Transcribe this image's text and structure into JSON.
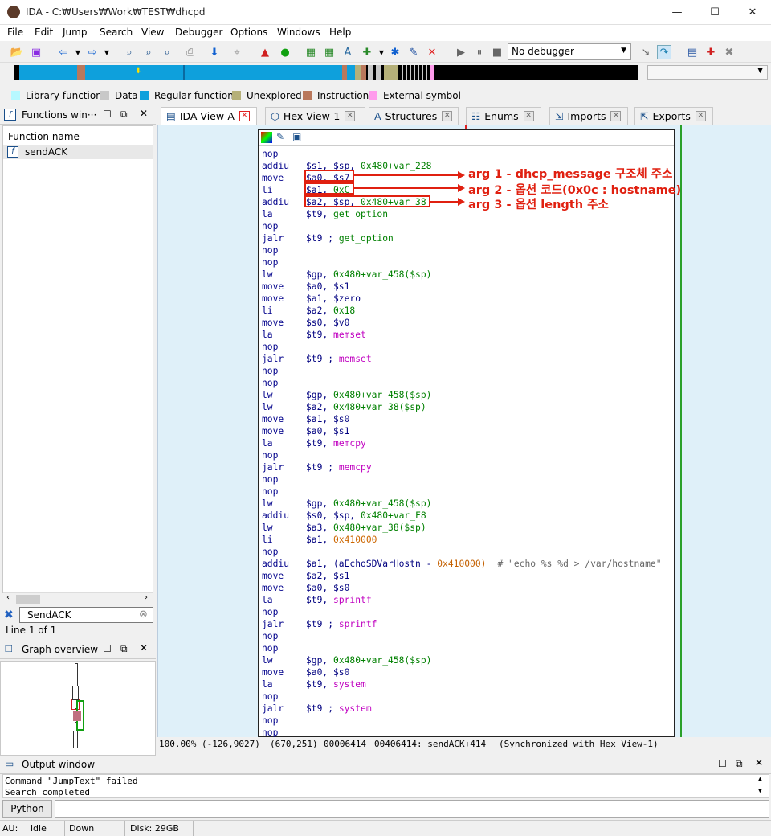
{
  "window": {
    "title": "IDA - C:₩Users₩Work₩TEST₩dhcpd",
    "min": "—",
    "max": "☐",
    "close": "✕"
  },
  "menu": [
    "File",
    "Edit",
    "Jump",
    "Search",
    "View",
    "Debugger",
    "Options",
    "Windows",
    "Help"
  ],
  "debugger_select": "No debugger",
  "legend": [
    {
      "label": "Library function",
      "color": "#b7f8ff"
    },
    {
      "label": "Data",
      "color": "#c8c8c8"
    },
    {
      "label": "Regular function",
      "color": "#0ea0dc"
    },
    {
      "label": "Unexplored",
      "color": "#b5b079"
    },
    {
      "label": "Instruction",
      "color": "#b9785c"
    },
    {
      "label": "External symbol",
      "color": "#ff9bec"
    }
  ],
  "functions_panel": {
    "title": "Functions win···",
    "column": "Function name",
    "items": [
      "sendACK"
    ],
    "search_value": "SendACK",
    "line_status": "Line 1 of 1"
  },
  "graph_overview": {
    "title": "Graph overview"
  },
  "tabs": [
    {
      "label": "IDA View-A",
      "active": true
    },
    {
      "label": "Hex View-1"
    },
    {
      "label": "Structures"
    },
    {
      "label": "Enums"
    },
    {
      "label": "Imports"
    },
    {
      "label": "Exports"
    }
  ],
  "code": [
    [
      "nop",
      "",
      ""
    ],
    [
      "addiu",
      "$s1, $sp, ",
      "0x480+var_228"
    ],
    [
      "move",
      "$a0, $s7",
      ""
    ],
    [
      "li",
      "$a1, ",
      "0xC"
    ],
    [
      "addiu",
      "$a2, $sp, ",
      "0x480+var_38"
    ],
    [
      "la",
      "$t9, ",
      "get_option"
    ],
    [
      "nop",
      "",
      ""
    ],
    [
      "jalr",
      "$t9 ; ",
      "get_option"
    ],
    [
      "nop",
      "",
      ""
    ],
    [
      "nop",
      "",
      ""
    ],
    [
      "lw",
      "$gp, ",
      "0x480+var_458($sp)"
    ],
    [
      "move",
      "$a0, $s1",
      ""
    ],
    [
      "move",
      "$a1, $zero",
      ""
    ],
    [
      "li",
      "$a2, ",
      "0x18"
    ],
    [
      "move",
      "$s0, $v0",
      ""
    ],
    [
      "la",
      "$t9, ",
      "memset"
    ],
    [
      "nop",
      "",
      ""
    ],
    [
      "jalr",
      "$t9 ; ",
      "memset"
    ],
    [
      "nop",
      "",
      ""
    ],
    [
      "nop",
      "",
      ""
    ],
    [
      "lw",
      "$gp, ",
      "0x480+var_458($sp)"
    ],
    [
      "lw",
      "$a2, ",
      "0x480+var_38($sp)"
    ],
    [
      "move",
      "$a1, $s0",
      ""
    ],
    [
      "move",
      "$a0, $s1",
      ""
    ],
    [
      "la",
      "$t9, ",
      "memcpy"
    ],
    [
      "nop",
      "",
      ""
    ],
    [
      "jalr",
      "$t9 ; ",
      "memcpy"
    ],
    [
      "nop",
      "",
      ""
    ],
    [
      "nop",
      "",
      ""
    ],
    [
      "lw",
      "$gp, ",
      "0x480+var_458($sp)"
    ],
    [
      "addiu",
      "$s0, $sp, ",
      "0x480+var_F8"
    ],
    [
      "lw",
      "$a3, ",
      "0x480+var_38($sp)"
    ],
    [
      "li",
      "$a1, ",
      "0x410000"
    ],
    [
      "nop",
      "",
      ""
    ],
    [
      "addiu",
      "$a1, (aEchoSDVarHostn - ",
      "0x410000)"
    ],
    [
      "move",
      "$a2, $s1",
      ""
    ],
    [
      "move",
      "$a0, $s0",
      ""
    ],
    [
      "la",
      "$t9, ",
      "sprintf"
    ],
    [
      "nop",
      "",
      ""
    ],
    [
      "jalr",
      "$t9 ; ",
      "sprintf"
    ],
    [
      "nop",
      "",
      ""
    ],
    [
      "nop",
      "",
      ""
    ],
    [
      "lw",
      "$gp, ",
      "0x480+var_458($sp)"
    ],
    [
      "move",
      "$a0, $s0",
      ""
    ],
    [
      "la",
      "$t9, ",
      "system"
    ],
    [
      "nop",
      "",
      ""
    ],
    [
      "jalr",
      "$t9 ; ",
      "system"
    ],
    [
      "nop",
      "",
      ""
    ],
    [
      "nop",
      "",
      ""
    ]
  ],
  "code_comment": "# \"echo %s %d > /var/hostname\"",
  "annotations": [
    "arg 1 - dhcp_message 구조체 주소",
    "arg 2 - 옵션 코드(0x0c : hostname)",
    "arg 3 - 옵션 length 주소"
  ],
  "status": {
    "zoom": "100.00%",
    "coords": "(-126,9027)",
    "pos": "(670,251)",
    "offset": "00006414",
    "addr": "00406414: sendACK+414",
    "sync": "(Synchronized with Hex View-1)"
  },
  "output": {
    "title": "Output window",
    "lines": [
      "Command \"JumpText\" failed",
      "Search completed"
    ],
    "python_btn": "Python"
  },
  "bottom": {
    "au": "AU:",
    "state": "idle",
    "dir": "Down",
    "disk": "Disk: 29GB"
  }
}
